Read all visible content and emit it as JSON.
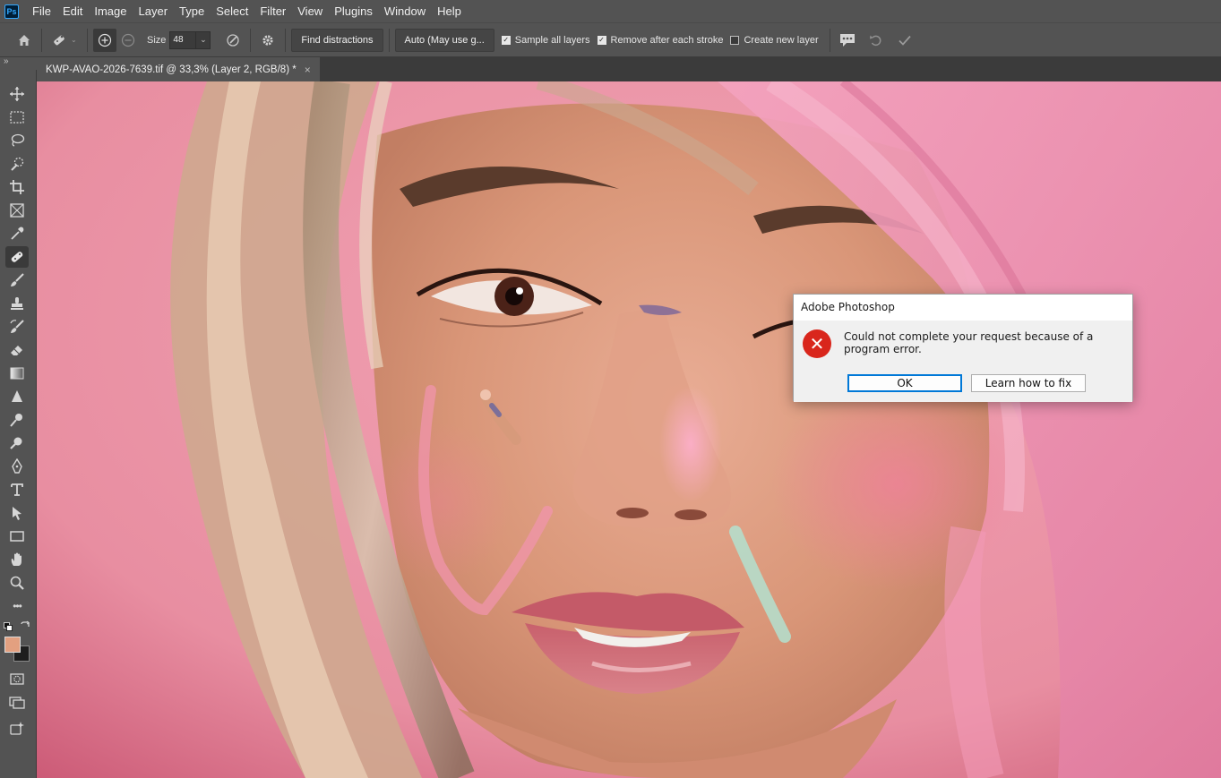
{
  "app": {
    "logo": "Ps",
    "menu": [
      "File",
      "Edit",
      "Image",
      "Layer",
      "Type",
      "Select",
      "Filter",
      "View",
      "Plugins",
      "Window",
      "Help"
    ]
  },
  "options": {
    "size_label": "Size",
    "size_value": "48",
    "find_distractions": "Find distractions",
    "mode_value": "Auto (May use g...",
    "sample_all_layers": "Sample all layers",
    "remove_after_stroke": "Remove after each stroke",
    "create_new_layer": "Create new layer"
  },
  "document": {
    "tab_title": "KWP-AVAO-2026-7639.tif @ 33,3% (Layer 2, RGB/8) *",
    "close_glyph": "×"
  },
  "toolbar": {
    "collapse_glyph": "»",
    "more_glyph": "•••"
  },
  "colors": {
    "foreground": "#e3a080",
    "background": "#1e1e1e"
  },
  "dialog": {
    "title": "Adobe Photoshop",
    "message": "Could not complete your request because of a program error.",
    "ok_label": "OK",
    "fix_label": "Learn how to fix",
    "icon_glyph": "✕"
  }
}
